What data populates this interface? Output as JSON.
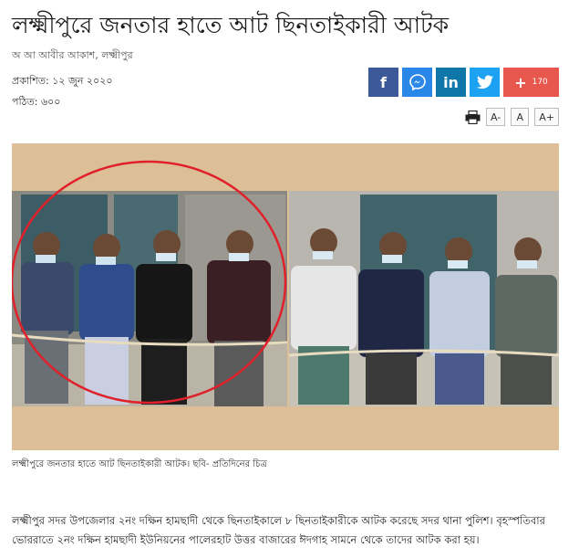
{
  "article": {
    "headline": "লক্ষ্মীপুরে জনতার হাতে আট ছিনতাইকারী আটক",
    "author": "অ আ আবীর আকাশ, লক্ষ্মীপুর",
    "published": "প্রকাশিত: ১২ জুন ২০২০",
    "views": "পঠিত: ৬০০",
    "caption": "লক্ষ্মীপুরে জনতার হাতে আট ছিনতাইকারী আটক। ছবি- প্রতিদিনের চিত্র",
    "body": "লক্ষ্মীপুর সদর উপজেলার ২নং দক্ষিন হামছাদী থেকে ছিনতাইকালে ৮ ছিনতাইকারীকে আটক করেছে সদর থানা পুলিশ। বৃহস্পতিবার ভোররাতে ২নং দক্ষিন হামছাদী ইউনিয়নের পালেরহাট উত্তর বাজারের ঈদগাহ সামনে থেকে তাদের আটক করা হয়।"
  },
  "share": {
    "facebook_glyph": "f",
    "messenger_glyph": "m",
    "linkedin_glyph": "in",
    "twitter_glyph": "t",
    "more_glyph": "+",
    "count": "170"
  },
  "font_controls": {
    "decrease": "A-",
    "reset": "A",
    "increase": "A+"
  },
  "colors": {
    "facebook": "#3b5998",
    "messenger": "#2a87e8",
    "linkedin": "#0e76a8",
    "twitter": "#1da1f2",
    "more": "#e8574d"
  }
}
